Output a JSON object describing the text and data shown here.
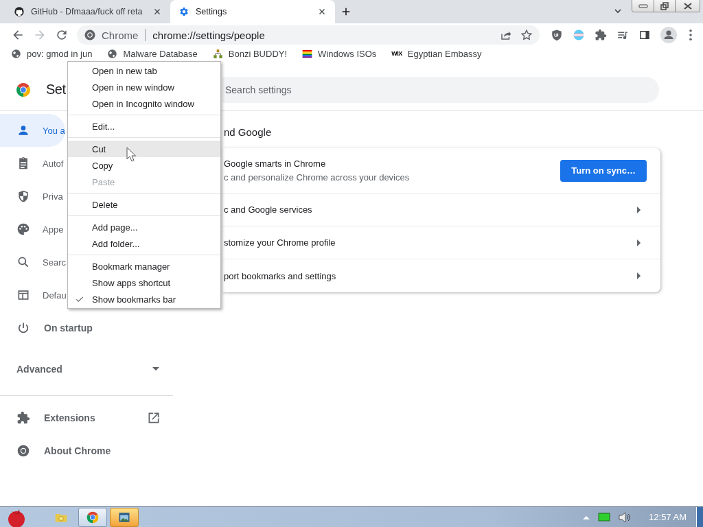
{
  "tabs": [
    {
      "title": "GitHub - Dfmaaa/fuck off reta",
      "kind": "github",
      "selected": false
    },
    {
      "title": "Settings",
      "kind": "gear",
      "selected": true
    }
  ],
  "address_bar": {
    "site": "Chrome",
    "url": "chrome://settings/people"
  },
  "bookmarks": [
    {
      "label": "pov: gmod in jun",
      "kind": "globe"
    },
    {
      "label": "Malware Database",
      "kind": "globe"
    },
    {
      "label": "Bonzi BUDDY!",
      "kind": "network"
    },
    {
      "label": "Windows ISOs",
      "kind": "rainbow"
    },
    {
      "label": "Egyptian Embassy",
      "kind": "wix",
      "icon_text": "WIX"
    }
  ],
  "settings": {
    "title": "Set",
    "search": {
      "placeholder": "Search settings"
    },
    "nav": [
      {
        "label": "You a",
        "kind": "person",
        "selected": true
      },
      {
        "label": "Autof",
        "kind": "clipboard",
        "selected": false
      },
      {
        "label": "Priva",
        "kind": "shield",
        "selected": false
      },
      {
        "label": "Appe",
        "kind": "palette",
        "selected": false
      },
      {
        "label": "Searc",
        "kind": "search",
        "selected": false
      },
      {
        "label": "Defau",
        "kind": "browser",
        "selected": false
      },
      {
        "label": "On startup",
        "kind": "power",
        "selected": false
      }
    ],
    "advanced": {
      "label": "Advanced",
      "expanded": false
    },
    "extra": [
      {
        "label": "Extensions",
        "kind": "puzzle",
        "external": true
      },
      {
        "label": "About Chrome",
        "kind": "chrome",
        "external": false
      }
    ],
    "section_title": "nd Google",
    "sync_card": {
      "title": "Google smarts in Chrome",
      "subtitle": "c and personalize Chrome across your devices",
      "button": "Turn on sync…"
    },
    "rows": [
      "c and Google services",
      "stomize your Chrome profile",
      "port bookmarks and settings"
    ]
  },
  "context_menu": {
    "groups": [
      {
        "items": [
          {
            "label": "Open in new tab",
            "disabled": false,
            "checked": false,
            "highlighted": false
          },
          {
            "label": "Open in new window",
            "disabled": false,
            "checked": false,
            "highlighted": false
          },
          {
            "label": "Open in Incognito window",
            "disabled": false,
            "checked": false,
            "highlighted": false
          }
        ]
      },
      {
        "items": [
          {
            "label": "Edit...",
            "disabled": false,
            "checked": false,
            "highlighted": false
          }
        ]
      },
      {
        "items": [
          {
            "label": "Cut",
            "disabled": false,
            "checked": false,
            "highlighted": true
          },
          {
            "label": "Copy",
            "disabled": false,
            "checked": false,
            "highlighted": false
          },
          {
            "label": "Paste",
            "disabled": true,
            "checked": false,
            "highlighted": false
          }
        ]
      },
      {
        "items": [
          {
            "label": "Delete",
            "disabled": false,
            "checked": false,
            "highlighted": false
          }
        ]
      },
      {
        "items": [
          {
            "label": "Add page...",
            "disabled": false,
            "checked": false,
            "highlighted": false
          },
          {
            "label": "Add folder...",
            "disabled": false,
            "checked": false,
            "highlighted": false
          }
        ]
      },
      {
        "items": [
          {
            "label": "Bookmark manager",
            "disabled": false,
            "checked": false,
            "highlighted": false
          },
          {
            "label": "Show apps shortcut",
            "disabled": false,
            "checked": false,
            "highlighted": false
          },
          {
            "label": "Show bookmarks bar",
            "disabled": false,
            "checked": true,
            "highlighted": false
          }
        ]
      }
    ]
  },
  "taskbar": {
    "apps": [
      {
        "kind": "folder",
        "open": false,
        "flashing": false
      },
      {
        "kind": "chrome",
        "open": true,
        "flashing": false
      },
      {
        "kind": "window",
        "open": true,
        "flashing": true
      }
    ],
    "clock": "12:57 AM"
  }
}
